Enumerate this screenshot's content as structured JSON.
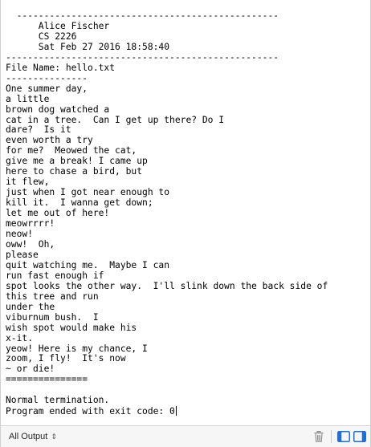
{
  "console": {
    "lines": [
      "  ------------------------------------------------",
      "      Alice Fischer",
      "      CS 2226",
      "      Sat Feb 27 2016 18:58:40",
      "--------------------------------------------------",
      "File Name: hello.txt",
      "---------------",
      "One summer day,",
      "a little",
      "brown dog watched a",
      "cat in a tree.  Can I get up there? Do I",
      "dare?  Is it",
      "even worth a try",
      "for me?  Meowed the cat,",
      "give me a break! I came up",
      "here to chase a bird, but",
      "it flew,",
      "just when I got near enough to",
      "kill it.  I wanna get down;",
      "let me out of here!",
      "meowrrrr!",
      "neow!",
      "oww!  Oh,",
      "please",
      "quit watching me.  Maybe I can",
      "run fast enough if",
      "spot looks the other way.  I'll slink down the back side of",
      "this tree and run",
      "under the",
      "viburnum bush.  I",
      "wish spot would make his",
      "x-it.",
      "yeow! Here is my chance, I",
      "zoom, I fly!  It's now",
      "~ or die!",
      "===============",
      "",
      "Normal termination.",
      "Program ended with exit code: 0"
    ]
  },
  "bottom_bar": {
    "filter_label": "All Output",
    "filter_icon": "up-down-chevron-icon",
    "trash_icon": "trash-icon",
    "left_pane_icon": "left-pane-toggle-icon",
    "right_pane_icon": "right-pane-toggle-icon",
    "accent_color": "#1f6fd6"
  }
}
